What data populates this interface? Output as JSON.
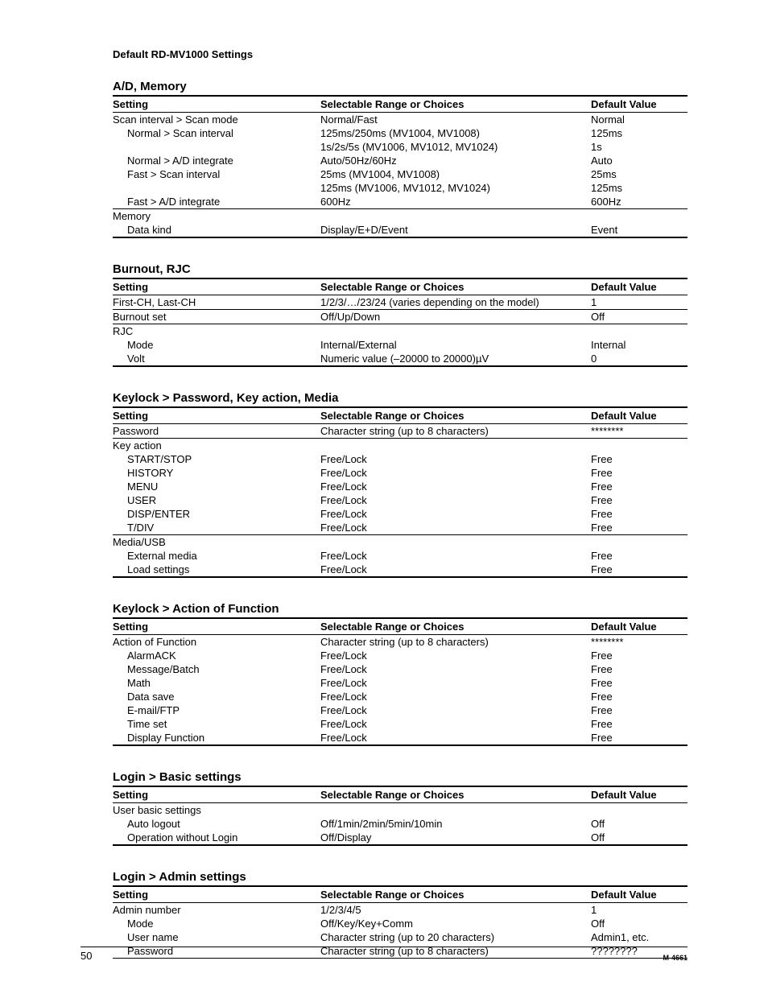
{
  "header": "Default RD-MV1000 Settings",
  "columns": {
    "setting": "Setting",
    "choices": "Selectable Range or Choices",
    "default": "Default Value"
  },
  "footer": {
    "page": "50",
    "doc": "M-4661"
  },
  "sections": [
    {
      "title": "A/D, Memory",
      "rows": [
        {
          "s": "Scan interval > Scan mode",
          "c": "Normal/Fast",
          "d": "Normal",
          "i": 0
        },
        {
          "s": "Normal > Scan interval",
          "c": "125ms/250ms (MV1004, MV1008)",
          "d": "125ms",
          "i": 1
        },
        {
          "s": "",
          "c": "1s/2s/5s (MV1006, MV1012, MV1024)",
          "d": "1s",
          "i": 1
        },
        {
          "s": "Normal > A/D integrate",
          "c": "Auto/50Hz/60Hz",
          "d": "Auto",
          "i": 1
        },
        {
          "s": "Fast > Scan interval",
          "c": "25ms (MV1004, MV1008)",
          "d": "25ms",
          "i": 1
        },
        {
          "s": "",
          "c": "125ms (MV1006, MV1012, MV1024)",
          "d": "125ms",
          "i": 1
        },
        {
          "s": "Fast > A/D integrate",
          "c": "600Hz",
          "d": "600Hz",
          "i": 1,
          "border": 1
        },
        {
          "s": "Memory",
          "c": "",
          "d": "",
          "i": 0
        },
        {
          "s": "Data kind",
          "c": "Display/E+D/Event",
          "d": "Event",
          "i": 1
        }
      ]
    },
    {
      "title": "Burnout, RJC",
      "rows": [
        {
          "s": "First-CH, Last-CH",
          "c": "1/2/3/…/23/24 (varies depending on the model)",
          "d": "1",
          "i": 0,
          "border": 1
        },
        {
          "s": "Burnout set",
          "c": "Off/Up/Down",
          "d": "Off",
          "i": 0,
          "border": 1
        },
        {
          "s": "RJC",
          "c": "",
          "d": "",
          "i": 0
        },
        {
          "s": "Mode",
          "c": "Internal/External",
          "d": "Internal",
          "i": 1
        },
        {
          "s": "Volt",
          "c": "Numeric value (–20000 to 20000)µV",
          "d": "0",
          "i": 1
        }
      ]
    },
    {
      "title": "Keylock > Password, Key action, Media",
      "rows": [
        {
          "s": "Password",
          "c": "Character string (up to 8 characters)",
          "d": "********",
          "i": 0,
          "border": 1
        },
        {
          "s": "Key action",
          "c": "",
          "d": "",
          "i": 0
        },
        {
          "s": "START/STOP",
          "c": "Free/Lock",
          "d": "Free",
          "i": 1
        },
        {
          "s": "HISTORY",
          "c": "Free/Lock",
          "d": "Free",
          "i": 1
        },
        {
          "s": "MENU",
          "c": "Free/Lock",
          "d": "Free",
          "i": 1
        },
        {
          "s": "USER",
          "c": "Free/Lock",
          "d": "Free",
          "i": 1
        },
        {
          "s": "DISP/ENTER",
          "c": "Free/Lock",
          "d": "Free",
          "i": 1
        },
        {
          "s": "T/DIV",
          "c": "Free/Lock",
          "d": "Free",
          "i": 1,
          "border": 1
        },
        {
          "s": "Media/USB",
          "c": "",
          "d": "",
          "i": 0
        },
        {
          "s": "External media",
          "c": "Free/Lock",
          "d": "Free",
          "i": 1
        },
        {
          "s": "Load settings",
          "c": "Free/Lock",
          "d": "Free",
          "i": 1
        }
      ]
    },
    {
      "title": "Keylock > Action of Function",
      "rows": [
        {
          "s": "Action of Function",
          "c": "Character string (up to 8 characters)",
          "d": "********",
          "i": 0
        },
        {
          "s": "AlarmACK",
          "c": "Free/Lock",
          "d": "Free",
          "i": 1
        },
        {
          "s": "Message/Batch",
          "c": "Free/Lock",
          "d": "Free",
          "i": 1
        },
        {
          "s": "Math",
          "c": "Free/Lock",
          "d": "Free",
          "i": 1
        },
        {
          "s": "Data save",
          "c": "Free/Lock",
          "d": "Free",
          "i": 1
        },
        {
          "s": "E-mail/FTP",
          "c": "Free/Lock",
          "d": "Free",
          "i": 1
        },
        {
          "s": "Time set",
          "c": "Free/Lock",
          "d": "Free",
          "i": 1
        },
        {
          "s": "Display Function",
          "c": "Free/Lock",
          "d": "Free",
          "i": 1
        }
      ]
    },
    {
      "title": "Login > Basic settings",
      "rows": [
        {
          "s": "User basic settings",
          "c": "",
          "d": "",
          "i": 0
        },
        {
          "s": "Auto logout",
          "c": "Off/1min/2min/5min/10min",
          "d": "Off",
          "i": 1
        },
        {
          "s": "Operation without Login",
          "c": "Off/Display",
          "d": "Off",
          "i": 1
        }
      ]
    },
    {
      "title": "Login > Admin settings",
      "rows": [
        {
          "s": "Admin number",
          "c": "1/2/3/4/5",
          "d": "1",
          "i": 0
        },
        {
          "s": "Mode",
          "c": "Off/Key/Key+Comm",
          "d": "Off",
          "i": 1
        },
        {
          "s": "User name",
          "c": "Character string (up to 20 characters)",
          "d": "Admin1, etc.",
          "i": 1
        },
        {
          "s": "Password",
          "c": "Character string (up to 8 characters)",
          "d": "????????",
          "i": 1
        }
      ],
      "noEndBorder": true
    }
  ]
}
